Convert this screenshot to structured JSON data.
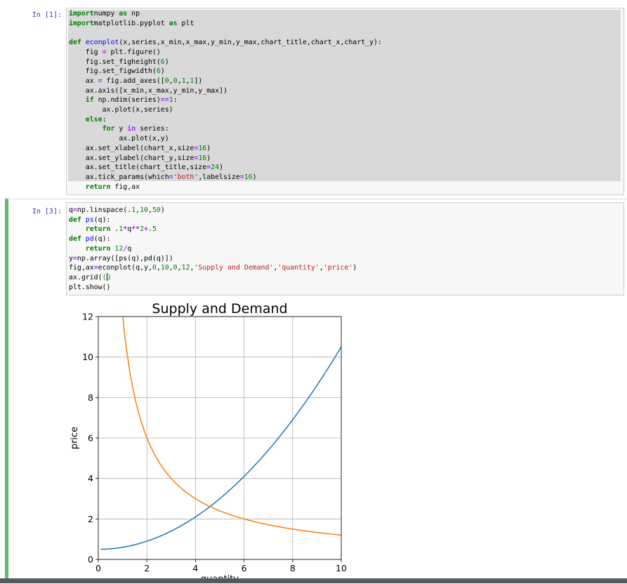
{
  "cells": [
    {
      "prompt": "In [1]:",
      "code_lines": [
        [
          [
            "kw",
            "import"
          ],
          [
            "",
            "numpy "
          ],
          [
            "kw",
            "as"
          ],
          [
            "",
            " np"
          ]
        ],
        [
          [
            "kw",
            "import"
          ],
          [
            "",
            "matplotlib.pyplot "
          ],
          [
            "kw",
            "as"
          ],
          [
            "",
            " plt"
          ]
        ],
        [],
        [
          [
            "kw",
            "def"
          ],
          [
            "",
            " "
          ],
          [
            "fn",
            "econplot"
          ],
          [
            "",
            "(x,series,x_min,x_max,y_min,y_max,chart_title,chart_x,chart_y):"
          ]
        ],
        [
          [
            "",
            "    fig "
          ],
          [
            "op",
            "="
          ],
          [
            "",
            " plt.figure()"
          ]
        ],
        [
          [
            "",
            "    fig.set_figheight("
          ],
          [
            "num",
            "6"
          ],
          [
            "",
            ")"
          ]
        ],
        [
          [
            "",
            "    fig.set_figwidth("
          ],
          [
            "num",
            "6"
          ],
          [
            "",
            ")"
          ]
        ],
        [
          [
            "",
            "    ax "
          ],
          [
            "op",
            "="
          ],
          [
            "",
            " fig.add_axes(["
          ],
          [
            "num",
            "0"
          ],
          [
            "",
            ","
          ],
          [
            "num",
            "0"
          ],
          [
            "",
            ","
          ],
          [
            "num",
            "1"
          ],
          [
            "",
            ","
          ],
          [
            "num",
            "1"
          ],
          [
            "",
            "])"
          ]
        ],
        [
          [
            "",
            "    ax.axis([x_min,x_max,y_min,y_max])"
          ]
        ],
        [
          [
            "",
            "    "
          ],
          [
            "kw",
            "if"
          ],
          [
            "",
            " np.ndim(series)"
          ],
          [
            "op",
            "=="
          ],
          [
            "num",
            "1"
          ],
          [
            "",
            ":"
          ]
        ],
        [
          [
            "",
            "        ax.plot(x,series)"
          ]
        ],
        [
          [
            "",
            "    "
          ],
          [
            "kw",
            "else"
          ],
          [
            "",
            ":"
          ]
        ],
        [
          [
            "",
            "        "
          ],
          [
            "kw",
            "for"
          ],
          [
            "",
            " y "
          ],
          [
            "op",
            "in"
          ],
          [
            "",
            " series:"
          ]
        ],
        [
          [
            "",
            "            ax.plot(x,y)"
          ]
        ],
        [
          [
            "",
            "    ax.set_xlabel(chart_x,size"
          ],
          [
            "op",
            "="
          ],
          [
            "num",
            "16"
          ],
          [
            "",
            ")"
          ]
        ],
        [
          [
            "",
            "    ax.set_ylabel(chart_y,size"
          ],
          [
            "op",
            "="
          ],
          [
            "num",
            "16"
          ],
          [
            "",
            ")"
          ]
        ],
        [
          [
            "",
            "    ax.set_title(chart_title,size"
          ],
          [
            "op",
            "="
          ],
          [
            "num",
            "24"
          ],
          [
            "",
            ")"
          ]
        ],
        [
          [
            "",
            "    ax.tick_params(which"
          ],
          [
            "op",
            "="
          ],
          [
            "str",
            "'both'"
          ],
          [
            "",
            ",labelsize"
          ],
          [
            "op",
            "="
          ],
          [
            "num",
            "16"
          ],
          [
            "",
            ")"
          ]
        ],
        [
          [
            "",
            "    "
          ],
          [
            "kw",
            "return"
          ],
          [
            "",
            " fig,ax"
          ]
        ]
      ]
    },
    {
      "prompt": "In [3]:",
      "code_lines": [
        [
          [
            "",
            "q"
          ],
          [
            "op",
            "="
          ],
          [
            "",
            "np.linspace(."
          ],
          [
            "num",
            "1"
          ],
          [
            "",
            ","
          ],
          [
            "num",
            "10"
          ],
          [
            "",
            ","
          ],
          [
            "num",
            "50"
          ],
          [
            "",
            ")"
          ]
        ],
        [
          [
            "kw",
            "def"
          ],
          [
            "",
            " "
          ],
          [
            "fn",
            "ps"
          ],
          [
            "",
            "(q):"
          ]
        ],
        [
          [
            "",
            "    "
          ],
          [
            "kw",
            "return"
          ],
          [
            "",
            " ."
          ],
          [
            "num",
            "1"
          ],
          [
            "op",
            "*"
          ],
          [
            "",
            "q"
          ],
          [
            "op",
            "**"
          ],
          [
            "num",
            "2"
          ],
          [
            "op",
            "+"
          ],
          [
            "",
            "."
          ],
          [
            "num",
            "5"
          ]
        ],
        [
          [
            "kw",
            "def"
          ],
          [
            "",
            " "
          ],
          [
            "fn",
            "pd"
          ],
          [
            "",
            "(q):"
          ]
        ],
        [
          [
            "",
            "    "
          ],
          [
            "kw",
            "return"
          ],
          [
            "",
            " "
          ],
          [
            "num",
            "12"
          ],
          [
            "op",
            "/"
          ],
          [
            "",
            "q"
          ]
        ],
        [
          [
            "",
            "y"
          ],
          [
            "op",
            "="
          ],
          [
            "",
            "np.array([ps(q),pd(q)])"
          ]
        ],
        [
          [
            "",
            "fig,ax"
          ],
          [
            "op",
            "="
          ],
          [
            "",
            "econplot(q,y,"
          ],
          [
            "num",
            "0"
          ],
          [
            "",
            ","
          ],
          [
            "num",
            "10"
          ],
          [
            "",
            ","
          ],
          [
            "num",
            "0"
          ],
          [
            "",
            ","
          ],
          [
            "num",
            "12"
          ],
          [
            "",
            ","
          ],
          [
            "str",
            "'Supply and Demand'"
          ],
          [
            "",
            ","
          ],
          [
            "str",
            "'quantity'"
          ],
          [
            "",
            ","
          ],
          [
            "str",
            "'price'"
          ],
          [
            "",
            ")"
          ]
        ],
        [
          [
            "",
            "ax.grid("
          ],
          [
            "num",
            "()"
          ],
          [
            ""
          ]
        ],
        [
          [
            "",
            "plt.show()"
          ]
        ]
      ]
    }
  ],
  "chart_data": {
    "type": "line",
    "title": "Supply and Demand",
    "xlabel": "quantity",
    "ylabel": "price",
    "xlim": [
      0,
      10
    ],
    "ylim": [
      0,
      12
    ],
    "xticks": [
      0,
      2,
      4,
      6,
      8,
      10
    ],
    "yticks": [
      0,
      2,
      4,
      6,
      8,
      10,
      12
    ],
    "grid": true,
    "series": [
      {
        "color": "#1f77b4",
        "formula": "0.1*q^2+0.5",
        "q_range": [
          0.1,
          10
        ],
        "points": 50
      },
      {
        "color": "#ff7f0e",
        "formula": "12/q",
        "q_range": [
          0.1,
          10
        ],
        "points": 50
      }
    ]
  }
}
